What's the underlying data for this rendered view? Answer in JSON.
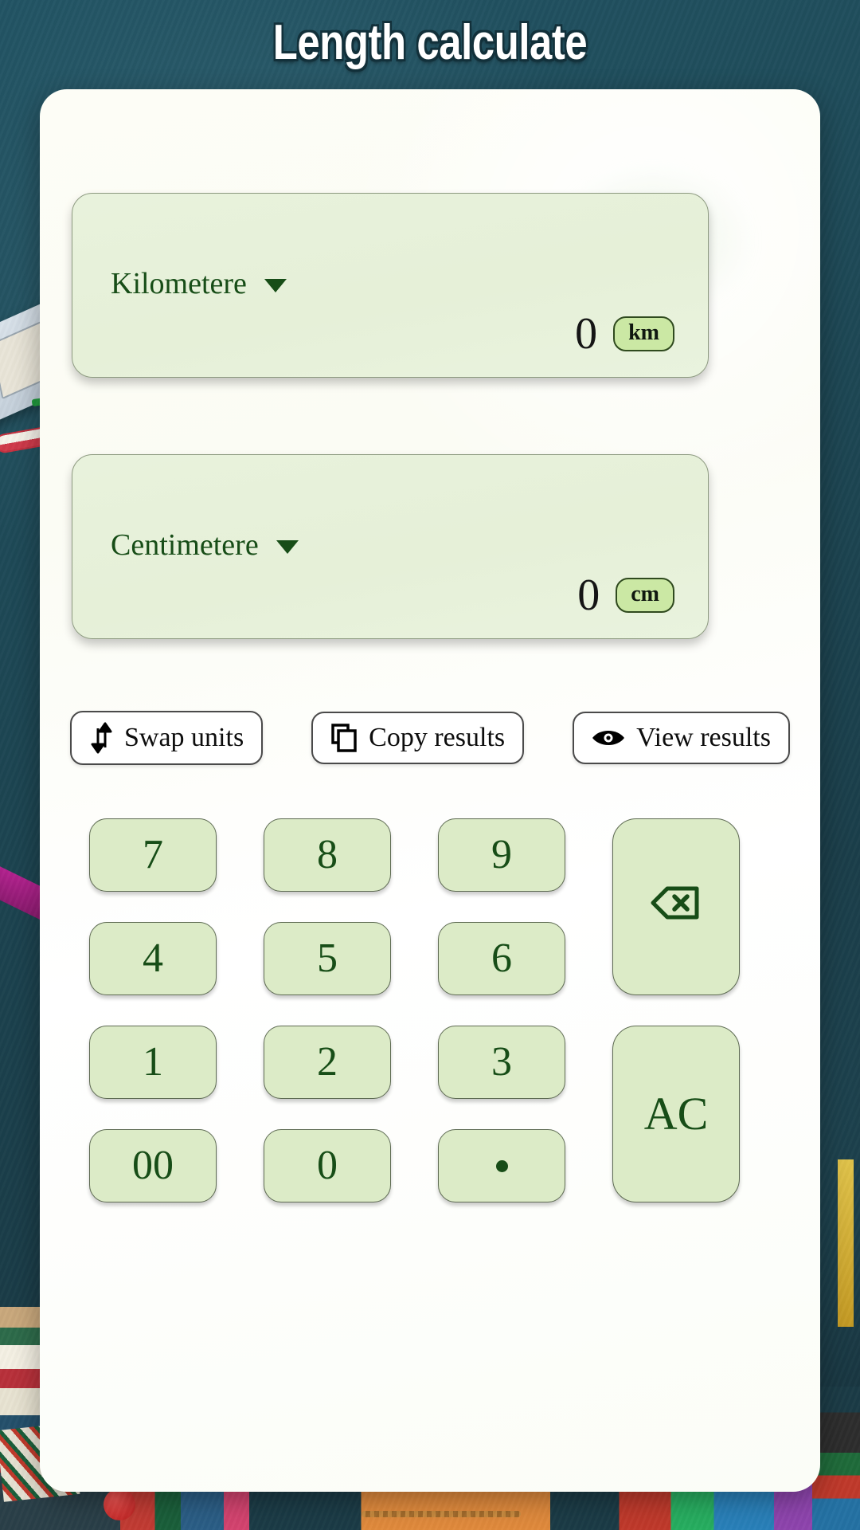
{
  "header": {
    "title": "Length calculate"
  },
  "colors": {
    "background": "#1e4a57",
    "panel": "#ffffff",
    "card_fill": "#e7f1da",
    "card_border": "#8d9a80",
    "key_fill": "#dcebc7",
    "key_border": "#5e6b53",
    "accent_text": "#174d17",
    "badge_fill": "#cbe8a4",
    "badge_border": "#2f4a1e"
  },
  "converter": {
    "from": {
      "unit_label": "Kilometere",
      "value": "0",
      "unit_symbol": "km",
      "caret_icon": "chevron-down-icon"
    },
    "to": {
      "unit_label": "Centimetere",
      "value": "0",
      "unit_symbol": "cm",
      "caret_icon": "chevron-down-icon"
    }
  },
  "actions": [
    {
      "id": "swap-units",
      "label": "Swap  units",
      "icon": "swap-vertical-icon"
    },
    {
      "id": "copy-results",
      "label": "Copy results",
      "icon": "copy-icon"
    },
    {
      "id": "view-results",
      "label": "View results",
      "icon": "eye-icon"
    }
  ],
  "keypad": {
    "keys": [
      {
        "id": "key-7",
        "label": "7",
        "type": "digit"
      },
      {
        "id": "key-8",
        "label": "8",
        "type": "digit"
      },
      {
        "id": "key-9",
        "label": "9",
        "type": "digit"
      },
      {
        "id": "key-backspace",
        "label": "",
        "type": "backspace",
        "icon": "backspace-icon"
      },
      {
        "id": "key-4",
        "label": "4",
        "type": "digit"
      },
      {
        "id": "key-5",
        "label": "5",
        "type": "digit"
      },
      {
        "id": "key-6",
        "label": "6",
        "type": "digit"
      },
      {
        "id": "key-1",
        "label": "1",
        "type": "digit"
      },
      {
        "id": "key-2",
        "label": "2",
        "type": "digit"
      },
      {
        "id": "key-3",
        "label": "3",
        "type": "digit"
      },
      {
        "id": "key-ac",
        "label": "AC",
        "type": "clear"
      },
      {
        "id": "key-00",
        "label": "00",
        "type": "digit"
      },
      {
        "id": "key-0",
        "label": "0",
        "type": "digit"
      },
      {
        "id": "key-decimal",
        "label": ".",
        "type": "decimal",
        "icon": "dot-icon"
      }
    ]
  }
}
